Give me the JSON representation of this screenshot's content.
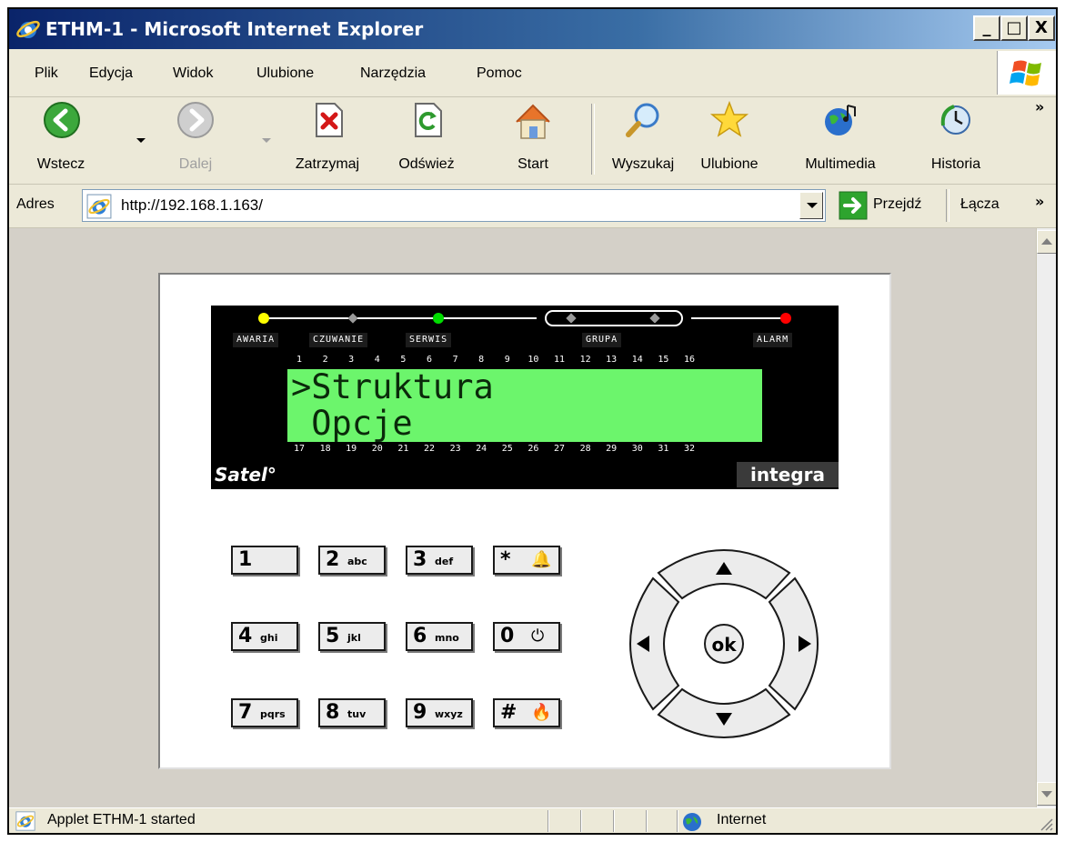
{
  "window": {
    "title": "ETHM-1 - Microsoft Internet Explorer",
    "minimize": "_",
    "maximize": "□",
    "close": "X"
  },
  "menu": [
    "Plik",
    "Edycja",
    "Widok",
    "Ulubione",
    "Narzędzia",
    "Pomoc"
  ],
  "toolbar": {
    "back": "Wstecz",
    "forward": "Dalej",
    "stop": "Zatrzymaj",
    "refresh": "Odśwież",
    "home": "Start",
    "search": "Wyszukaj",
    "favorites": "Ulubione",
    "media": "Multimedia",
    "history": "Historia",
    "more": "»"
  },
  "address": {
    "label": "Adres",
    "url": "http://192.168.1.163/",
    "go": "Przejdź",
    "links": "Łącza",
    "more": "»"
  },
  "keypad": {
    "indicators": {
      "awaria": "AWARIA",
      "czuwanie": "CZUWANIE",
      "serwis": "SERWIS",
      "grupa": "GRUPA",
      "alarm": "ALARM"
    },
    "top_numbers": [
      "1",
      "2",
      "3",
      "4",
      "5",
      "6",
      "7",
      "8",
      "9",
      "10",
      "11",
      "12",
      "13",
      "14",
      "15",
      "16"
    ],
    "bottom_numbers": [
      "17",
      "18",
      "19",
      "20",
      "21",
      "22",
      "23",
      "24",
      "25",
      "26",
      "27",
      "28",
      "29",
      "30",
      "31",
      "32"
    ],
    "display": {
      "line1": ">Struktura",
      "line2": " Opcje"
    },
    "brand": "Satel°",
    "model": "integra",
    "keys": [
      {
        "main": "1",
        "sub": ""
      },
      {
        "main": "2",
        "sub": "abc"
      },
      {
        "main": "3",
        "sub": "def"
      },
      {
        "main": "*",
        "sub": "",
        "sym": "🔔"
      },
      {
        "main": "4",
        "sub": "ghi"
      },
      {
        "main": "5",
        "sub": "jkl"
      },
      {
        "main": "6",
        "sub": "mno"
      },
      {
        "main": "0",
        "sub": "",
        "sym": "⏻"
      },
      {
        "main": "7",
        "sub": "pqrs"
      },
      {
        "main": "8",
        "sub": "tuv"
      },
      {
        "main": "9",
        "sub": "wxyz"
      },
      {
        "main": "#",
        "sub": "",
        "sym": "🔥"
      }
    ],
    "ok_label": "ok"
  },
  "status": {
    "text": "Applet ETHM-1 started",
    "zone": "Internet"
  },
  "colors": {
    "led_awaria": "#ffff00",
    "led_serwis": "#00dd00",
    "led_alarm": "#ff0000",
    "lcd_background": "#6cf56c"
  }
}
